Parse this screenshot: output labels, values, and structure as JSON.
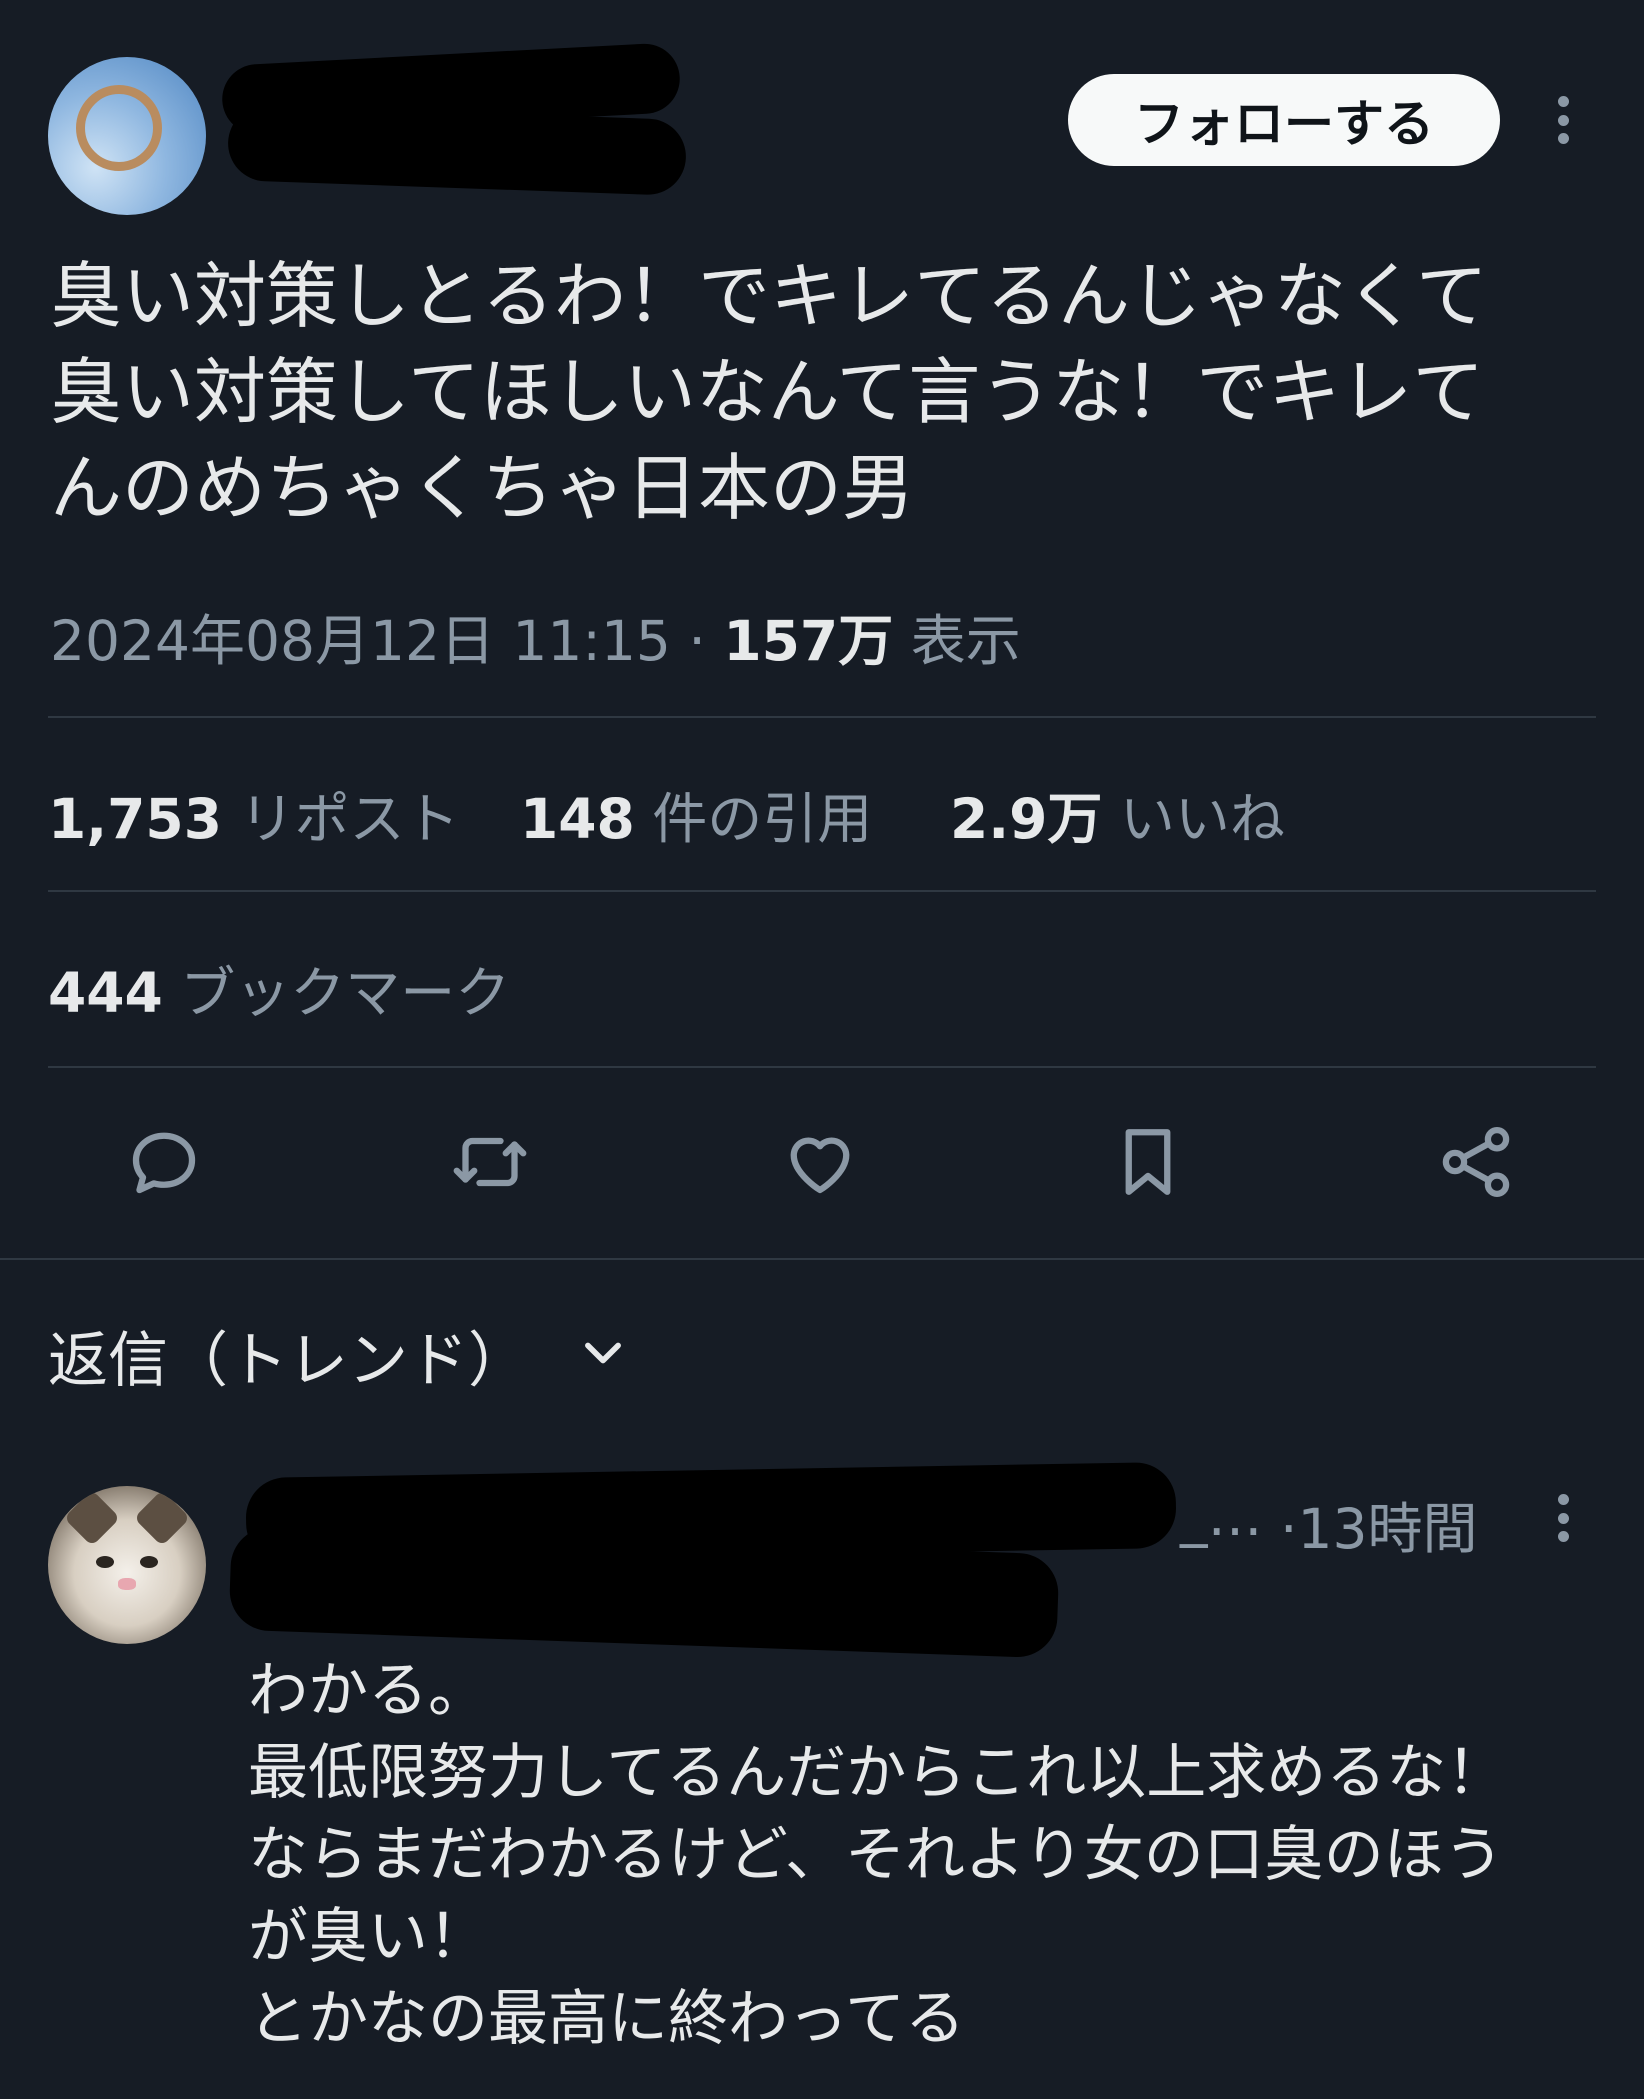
{
  "tweet": {
    "follow_label": "フォローする",
    "text": "臭い対策しとるわ！でキレてるんじゃなくて\n臭い対策してほしいなんて言うな！でキレて\nんのめちゃくちゃ日本の男",
    "datetime": "2024年08月12日 11:15",
    "separator": "·",
    "views_count": "157万",
    "views_label": "表示"
  },
  "stats": {
    "reposts_count": "1,753",
    "reposts_label": "リポスト",
    "quotes_count": "148",
    "quotes_label": "件の引用",
    "likes_count": "2.9万",
    "likes_label": "いいね",
    "bookmarks_count": "444",
    "bookmarks_label": "ブックマーク"
  },
  "actions": [
    "reply-icon",
    "repost-icon",
    "like-icon",
    "bookmark-icon",
    "share-icon"
  ],
  "replies_sort": {
    "label": "返信（トレンド）",
    "icon": "chevron-down-icon"
  },
  "reply": {
    "handle_tail": "_…",
    "time": "·13時間",
    "text": "わかる。\n最低限努力してるんだからこれ以上求めるな！\nならまだわかるけど、それより女の口臭のほう\nが臭い！\nとかなの最高に終わってる"
  },
  "colors": {
    "background": "#161c25",
    "text_primary": "#e7e9ea",
    "text_secondary": "#8b98a5",
    "divider": "#2f3842",
    "follow_button_bg": "#f7f9f9"
  }
}
